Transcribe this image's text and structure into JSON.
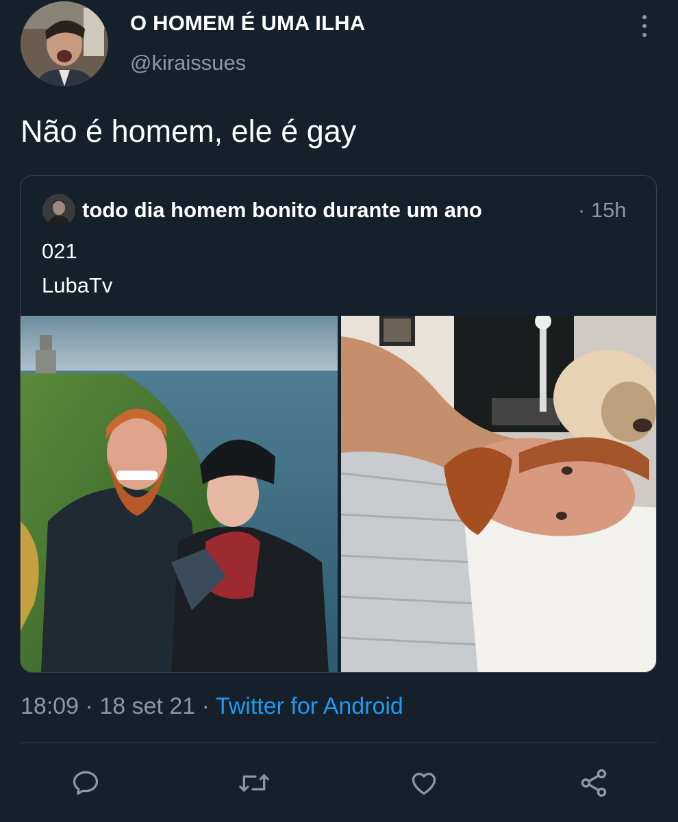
{
  "author": {
    "display_name": "O HOMEM É UMA ILHA",
    "handle": "@kiraissues"
  },
  "tweet": {
    "text": "Não é homem, ele é gay"
  },
  "quoted_tweet": {
    "author_name": "todo dia homem bonito durante um ano",
    "time": "· 15h",
    "line1": "021",
    "line2": "LubaTv"
  },
  "meta": {
    "time": "18:09",
    "date": "18 set 21",
    "source": "Twitter for Android"
  },
  "actions": [
    "reply-icon",
    "retweet-icon",
    "like-icon",
    "share-icon"
  ],
  "colors": {
    "background": "#15202b",
    "secondary_text": "#8b98a5",
    "accent": "#1d9bf0",
    "border": "#38444d"
  }
}
